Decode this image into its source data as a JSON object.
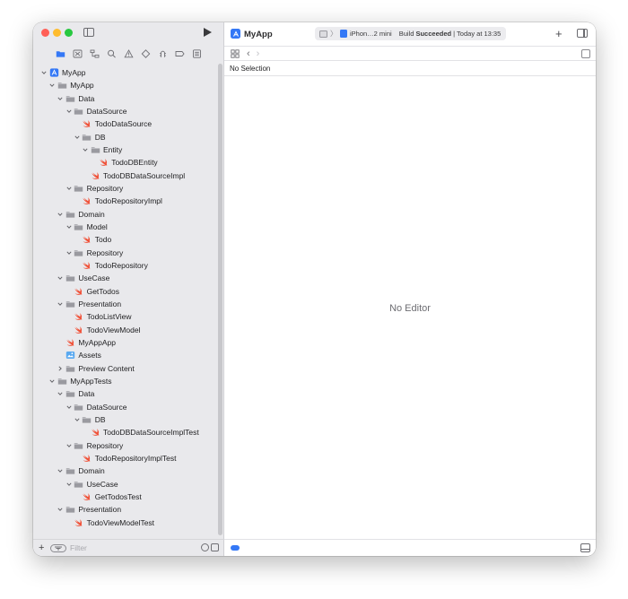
{
  "window": {
    "project_name": "MyApp",
    "scheme_device": "iPhon…2 mini",
    "build_status_prefix": "Build ",
    "build_status_bold": "Succeeded",
    "build_status_suffix": " | Today at 13:35",
    "add_label": "+"
  },
  "navigator_tabs": [
    {
      "name": "folder-icon",
      "active": true
    },
    {
      "name": "source-control-icon",
      "active": false
    },
    {
      "name": "symbol-icon",
      "active": false
    },
    {
      "name": "find-icon",
      "active": false
    },
    {
      "name": "issue-icon",
      "active": false
    },
    {
      "name": "test-icon",
      "active": false
    },
    {
      "name": "debug-icon",
      "active": false
    },
    {
      "name": "breakpoint-icon",
      "active": false
    },
    {
      "name": "report-icon",
      "active": false
    }
  ],
  "tree": [
    {
      "label": "MyApp",
      "depth": 0,
      "kind": "project",
      "expanded": true
    },
    {
      "label": "MyApp",
      "depth": 1,
      "kind": "group",
      "expanded": true
    },
    {
      "label": "Data",
      "depth": 2,
      "kind": "group",
      "expanded": true
    },
    {
      "label": "DataSource",
      "depth": 3,
      "kind": "group",
      "expanded": true
    },
    {
      "label": "TodoDataSource",
      "depth": 4,
      "kind": "swift"
    },
    {
      "label": "DB",
      "depth": 4,
      "kind": "group",
      "expanded": true
    },
    {
      "label": "Entity",
      "depth": 5,
      "kind": "group",
      "expanded": true
    },
    {
      "label": "TodoDBEntity",
      "depth": 6,
      "kind": "swift"
    },
    {
      "label": "TodoDBDataSourceImpl",
      "depth": 5,
      "kind": "swift"
    },
    {
      "label": "Repository",
      "depth": 3,
      "kind": "group",
      "expanded": true
    },
    {
      "label": "TodoRepositoryImpl",
      "depth": 4,
      "kind": "swift"
    },
    {
      "label": "Domain",
      "depth": 2,
      "kind": "group",
      "expanded": true
    },
    {
      "label": "Model",
      "depth": 3,
      "kind": "group",
      "expanded": true
    },
    {
      "label": "Todo",
      "depth": 4,
      "kind": "swift"
    },
    {
      "label": "Repository",
      "depth": 3,
      "kind": "group",
      "expanded": true
    },
    {
      "label": "TodoRepository",
      "depth": 4,
      "kind": "swift"
    },
    {
      "label": "UseCase",
      "depth": 2,
      "kind": "group",
      "expanded": true
    },
    {
      "label": "GetTodos",
      "depth": 3,
      "kind": "swift"
    },
    {
      "label": "Presentation",
      "depth": 2,
      "kind": "group",
      "expanded": true
    },
    {
      "label": "TodoListView",
      "depth": 3,
      "kind": "swift"
    },
    {
      "label": "TodoViewModel",
      "depth": 3,
      "kind": "swift"
    },
    {
      "label": "MyAppApp",
      "depth": 2,
      "kind": "swift"
    },
    {
      "label": "Assets",
      "depth": 2,
      "kind": "assets"
    },
    {
      "label": "Preview Content",
      "depth": 2,
      "kind": "group",
      "expanded": false
    },
    {
      "label": "MyAppTests",
      "depth": 1,
      "kind": "group",
      "expanded": true
    },
    {
      "label": "Data",
      "depth": 2,
      "kind": "group",
      "expanded": true
    },
    {
      "label": "DataSource",
      "depth": 3,
      "kind": "group",
      "expanded": true
    },
    {
      "label": "DB",
      "depth": 4,
      "kind": "group",
      "expanded": true
    },
    {
      "label": "TodoDBDataSourceImplTest",
      "depth": 5,
      "kind": "swift"
    },
    {
      "label": "Repository",
      "depth": 3,
      "kind": "group",
      "expanded": true
    },
    {
      "label": "TodoRepositoryImplTest",
      "depth": 4,
      "kind": "swift"
    },
    {
      "label": "Domain",
      "depth": 2,
      "kind": "group",
      "expanded": true
    },
    {
      "label": "UseCase",
      "depth": 3,
      "kind": "group",
      "expanded": true
    },
    {
      "label": "GetTodosTest",
      "depth": 4,
      "kind": "swift"
    },
    {
      "label": "Presentation",
      "depth": 2,
      "kind": "group",
      "expanded": true
    },
    {
      "label": "TodoViewModelTest",
      "depth": 3,
      "kind": "swift"
    }
  ],
  "filter": {
    "placeholder": "Filter",
    "add_label": "+"
  },
  "editor": {
    "no_selection": "No Selection",
    "no_editor": "No Editor"
  },
  "colors": {
    "accent": "#3478f6",
    "swift": "#f05138",
    "folder": "#8e8e93"
  }
}
